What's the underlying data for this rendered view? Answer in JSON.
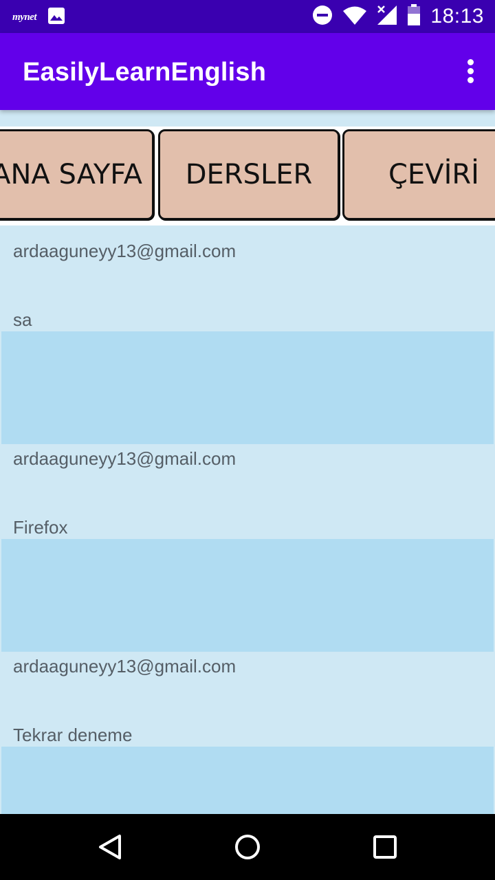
{
  "status_bar": {
    "carrier_logo": "mynet",
    "time": "18:13",
    "icons": [
      "mynet-logo",
      "image-icon",
      "do-not-disturb-icon",
      "wifi-icon",
      "signal-no-data-icon",
      "battery-icon"
    ]
  },
  "app_bar": {
    "title": "EasilyLearnEnglish",
    "overflow_icon": "more-vert-icon"
  },
  "tabs": [
    {
      "label": "ANA SAYFA"
    },
    {
      "label": "DERSLER"
    },
    {
      "label": "ÇEVİRİ"
    }
  ],
  "posts": [
    {
      "email": "ardaaguneyy13@gmail.com",
      "message": "sa"
    },
    {
      "email": "ardaaguneyy13@gmail.com",
      "message": "Firefox"
    },
    {
      "email": "ardaaguneyy13@gmail.com",
      "message": "Tekrar deneme"
    }
  ],
  "nav_bar": {
    "icons": [
      "back-icon",
      "home-icon",
      "recents-icon"
    ]
  },
  "colors": {
    "status_bar": "#3a00b0",
    "app_bar": "#6200ea",
    "background": "#cfe8f4",
    "post_box": "#b0dcf2",
    "tab_button": "#e2bfac"
  }
}
